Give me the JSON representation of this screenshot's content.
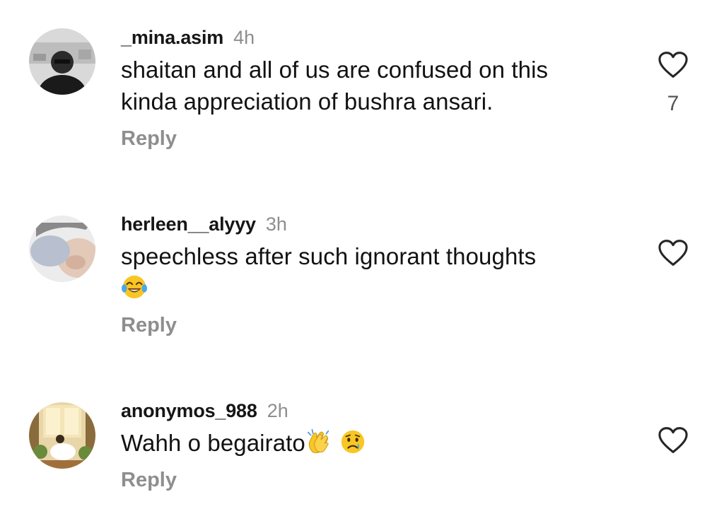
{
  "comments": [
    {
      "username": "_mina.asim",
      "time": "4h",
      "text_line1": "shaitan and all of us are confused on this",
      "text_line2": "kinda appreciation of bushra ansari.",
      "likes": "7",
      "reply_label": "Reply"
    },
    {
      "username": "herleen__alyyy",
      "time": "3h",
      "text_line1": "speechless after such ignorant thoughts",
      "emojis": [
        "face-with-tears-of-joy"
      ],
      "reply_label": "Reply"
    },
    {
      "username": "anonymos_988",
      "time": "2h",
      "text_line1": "Wahh o begairato",
      "emojis": [
        "clapping-hands",
        "crying-face"
      ],
      "reply_label": "Reply"
    }
  ],
  "icons": {
    "like": "heart-outline-icon"
  },
  "colors": {
    "secondary_text": "#8e8e8e",
    "primary_text": "#121212",
    "emoji_yellow": "#f9c623"
  }
}
